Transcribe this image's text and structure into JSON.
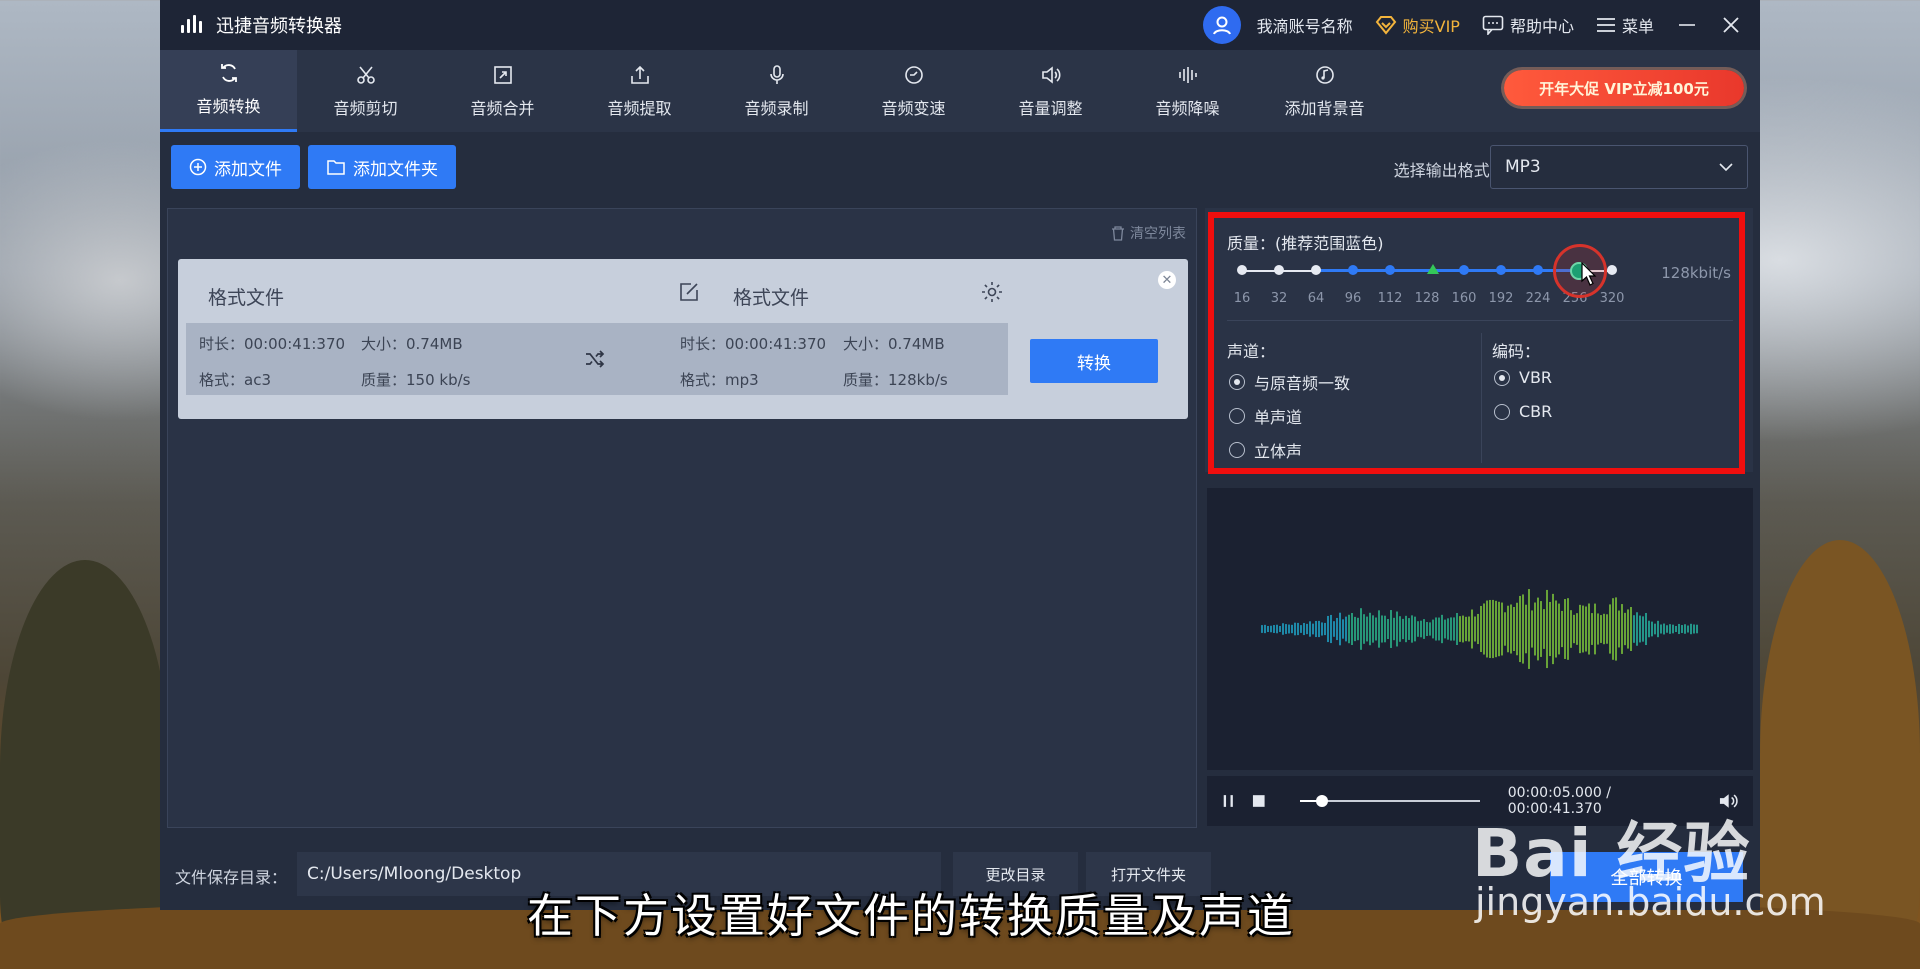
{
  "app": {
    "title": "迅捷音频转换器",
    "account": "我滴账号名称",
    "buy_vip": "购买VIP",
    "help": "帮助中心",
    "menu": "菜单"
  },
  "toolbar": {
    "tools": [
      {
        "label": "音频转换",
        "icon": "convert-icon"
      },
      {
        "label": "音频剪切",
        "icon": "scissors-icon"
      },
      {
        "label": "音频合并",
        "icon": "merge-icon"
      },
      {
        "label": "音频提取",
        "icon": "extract-icon"
      },
      {
        "label": "音频录制",
        "icon": "microphone-icon"
      },
      {
        "label": "音频变速",
        "icon": "speed-icon"
      },
      {
        "label": "音量调整",
        "icon": "volume-icon"
      },
      {
        "label": "音频降噪",
        "icon": "denoise-icon"
      },
      {
        "label": "添加背景音",
        "icon": "music-icon"
      }
    ],
    "promo": "开年大促 VIP立减100元"
  },
  "actions": {
    "add_file": "添加文件",
    "add_folder": "添加文件夹",
    "format_label": "选择输出格式:",
    "format_value": "MP3"
  },
  "file_list": {
    "clear_list": "清空列表",
    "source": {
      "title": "格式文件",
      "duration": "时长：00:00:41:370",
      "size": "大小：0.74MB",
      "format": "格式：ac3",
      "quality": "质量：150 kb/s"
    },
    "target": {
      "title": "格式文件",
      "duration": "时长：00:00:41:370",
      "size": "大小：0.74MB",
      "format": "格式：mp3",
      "quality": "质量：128kb/s"
    },
    "convert_button": "转换"
  },
  "quality": {
    "label": "质量：(推荐范围蓝色)",
    "rate": "128kbit/s",
    "ticks": [
      "16",
      "32",
      "64",
      "96",
      "112",
      "128",
      "160",
      "192",
      "224",
      "256",
      "320"
    ],
    "selected_tick": "256",
    "channel_label": "声道：",
    "channel_options": [
      "与原音频一致",
      "单声道",
      "立体声"
    ],
    "channel_selected": "与原音频一致",
    "encoding_label": "编码：",
    "encoding_options": [
      "VBR",
      "CBR"
    ],
    "encoding_selected": "VBR"
  },
  "player": {
    "time": "00:00:05.000 / 00:00:41.370",
    "progress": 0.12
  },
  "footer": {
    "save_label": "文件保存目录：",
    "save_path": "C:/Users/Mloong/Desktop",
    "change_dir": "更改目录",
    "open_folder": "打开文件夹",
    "convert_all": "全部转换"
  },
  "overlay": {
    "subtitle": "在下方设置好文件的转换质量及声道",
    "watermark_logo": "Bai 经验",
    "watermark_url": "jingyan.baidu.com"
  },
  "colors": {
    "accent": "#2f7af5",
    "highlight": "#f00e0e",
    "vip": "#f3b43c"
  }
}
